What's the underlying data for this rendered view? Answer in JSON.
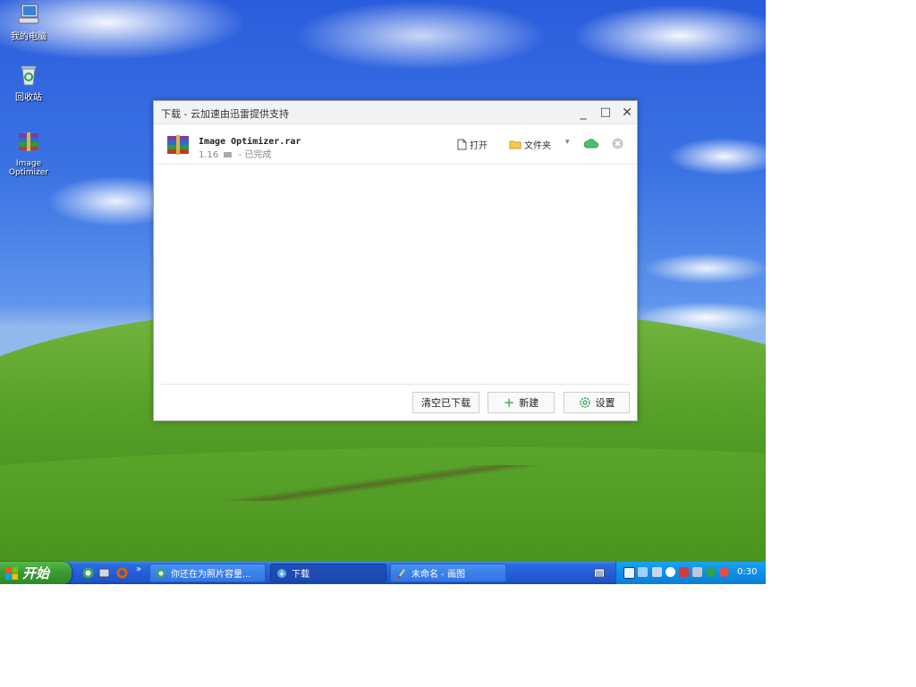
{
  "desktop": {
    "icons": [
      {
        "label": "我的电脑",
        "icon": "my-computer-icon"
      },
      {
        "label": "回收站",
        "icon": "recycle-bin-icon"
      },
      {
        "label": "Image Optimizer",
        "icon": "winrar-archive-icon"
      }
    ]
  },
  "window": {
    "title": "下载 - 云加速由迅雷提供支持",
    "controls": {
      "minimize": "_",
      "maximize": "□",
      "close": "✕"
    },
    "item": {
      "file_name": "Image Optimizer.rar",
      "size": "1.16",
      "status": "- 已完成",
      "open_label": "打开",
      "folder_label": "文件夹",
      "dropdown_glyph": "▾"
    },
    "footer": {
      "clear_label": "清空已下载",
      "new_label": "新建",
      "settings_label": "设置"
    }
  },
  "taskbar": {
    "start_label": "开始",
    "chevron": "»",
    "tasks": [
      {
        "label": "你还在为照片容量..."
      },
      {
        "label": "下载"
      },
      {
        "label": "未命名 - 画图"
      }
    ],
    "clock": "0:30"
  },
  "colors": {
    "taskbar_blue": "#245edb",
    "start_green": "#3c9a34",
    "tray_blue": "#0f8ee6",
    "accent_green": "#2fa24b"
  }
}
